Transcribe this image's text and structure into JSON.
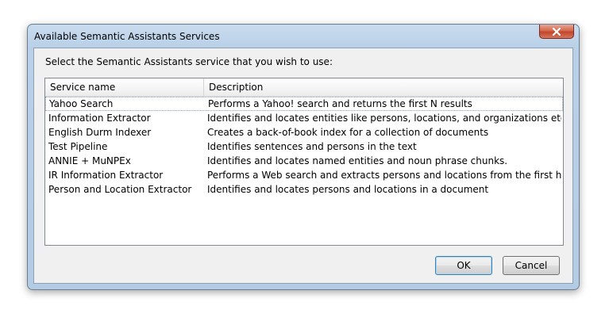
{
  "window": {
    "title": "Available Semantic Assistants Services"
  },
  "dialog": {
    "prompt": "Select the Semantic Assistants service that you wish to use:",
    "columns": [
      "Service name",
      "Description"
    ],
    "rows": [
      {
        "name": "Yahoo Search",
        "description": "Performs a Yahoo! search and returns the first N results"
      },
      {
        "name": "Information Extractor",
        "description": "Identifies and locates entities like persons, locations, and organizations etc."
      },
      {
        "name": "English Durm Indexer",
        "description": "Creates a back-of-book index for a collection of documents"
      },
      {
        "name": "Test Pipeline",
        "description": "Identifies sentences and persons in the text"
      },
      {
        "name": "ANNIE + MuNPEx",
        "description": "Identifies and locates named entities and noun phrase chunks."
      },
      {
        "name": "IR Information Extractor",
        "description": "Performs a Web search and extracts persons and locations from the first hits"
      },
      {
        "name": "Person and Location Extractor",
        "description": "Identifies and locates persons and locations in a document"
      }
    ],
    "selected_row": 0
  },
  "buttons": {
    "ok": "OK",
    "cancel": "Cancel"
  },
  "icons": {
    "close": "close-icon"
  }
}
